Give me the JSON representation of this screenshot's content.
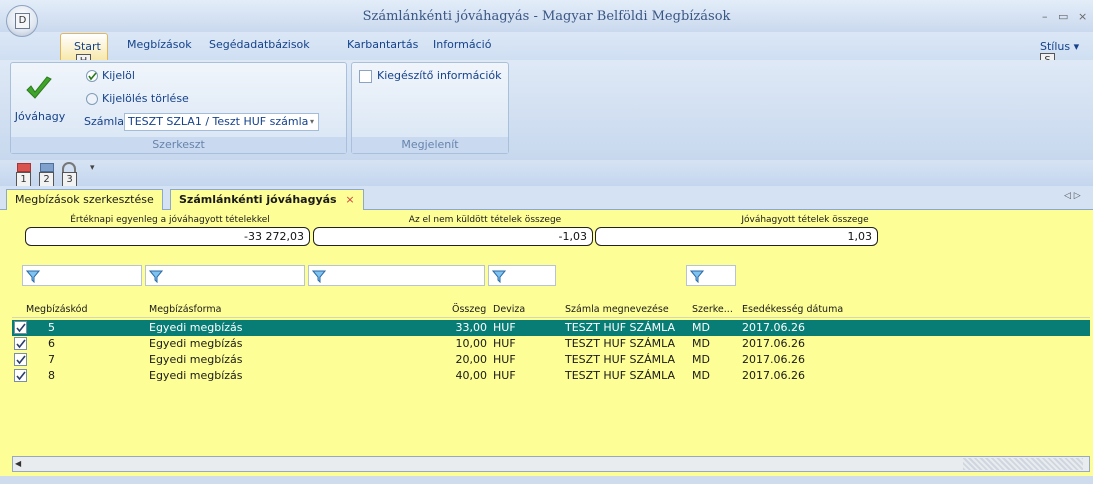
{
  "window": {
    "title": "Számlánkénti jóváhagyás - Magyar Belföldi Megbízások",
    "orb_key": "D",
    "min_glyph": "–",
    "restore_glyph": "▭",
    "close_glyph": "×"
  },
  "ribbon_tabs": [
    {
      "label": "Start",
      "key": "H"
    },
    {
      "label": "Megbízások"
    },
    {
      "label": "Segédadatbázisok"
    },
    {
      "label": "Karbantartás"
    },
    {
      "label": "Információ"
    }
  ],
  "style_menu": {
    "label": "Stílus",
    "key": "S"
  },
  "groups": {
    "edit": {
      "label": "Szerkeszt",
      "approve_label": "Jóváhagy",
      "select_label": "Kijelöl",
      "clear_label": "Kijelölés törlése",
      "account_label": "Számla",
      "account_value": "TESZT SZLA1 / Teszt HUF számla"
    },
    "display": {
      "label": "Megjelenít",
      "extra_info_label": "Kiegészítő információk"
    }
  },
  "qat_keys": [
    "1",
    "2",
    "3"
  ],
  "qat_more": "▾",
  "doc_tabs": [
    {
      "label": "Megbízások szerkesztése",
      "active": false
    },
    {
      "label": "Számlánkénti jóváhagyás",
      "active": true,
      "close": "×"
    }
  ],
  "doc_nav": "◁  ▷",
  "summary": [
    {
      "label": "Értéknapi egyenleg a jóváhagyott tételekkel",
      "value": "-33 272,03"
    },
    {
      "label": "Az el nem küldött tételek összege",
      "value": "-1,03"
    },
    {
      "label": "Jóváhagyott tételek összege",
      "value": "1,03"
    }
  ],
  "columns": [
    "Megbízáskód",
    "Megbízásforma",
    "Összeg",
    "Deviza",
    "Számla megnevezése",
    "Szerke...",
    "Esedékesség dátuma"
  ],
  "rows": [
    {
      "checked": true,
      "code": "5",
      "form": "Egyedi megbízás",
      "amount": "33,00",
      "currency": "HUF",
      "account": "TESZT HUF SZÁMLA",
      "editor": "MD",
      "due": "2017.06.26",
      "selected": true
    },
    {
      "checked": true,
      "code": "6",
      "form": "Egyedi megbízás",
      "amount": "10,00",
      "currency": "HUF",
      "account": "TESZT HUF SZÁMLA",
      "editor": "MD",
      "due": "2017.06.26",
      "selected": false
    },
    {
      "checked": true,
      "code": "7",
      "form": "Egyedi megbízás",
      "amount": "20,00",
      "currency": "HUF",
      "account": "TESZT HUF SZÁMLA",
      "editor": "MD",
      "due": "2017.06.26",
      "selected": false
    },
    {
      "checked": true,
      "code": "8",
      "form": "Egyedi megbízás",
      "amount": "40,00",
      "currency": "HUF",
      "account": "TESZT HUF SZÁMLA",
      "editor": "MD",
      "due": "2017.06.26",
      "selected": false
    }
  ],
  "colors": {
    "content_bg": "#fefe96",
    "selected_row": "#087d75",
    "title_text": "#3a5683",
    "accent_tab": "#e2b65a"
  }
}
